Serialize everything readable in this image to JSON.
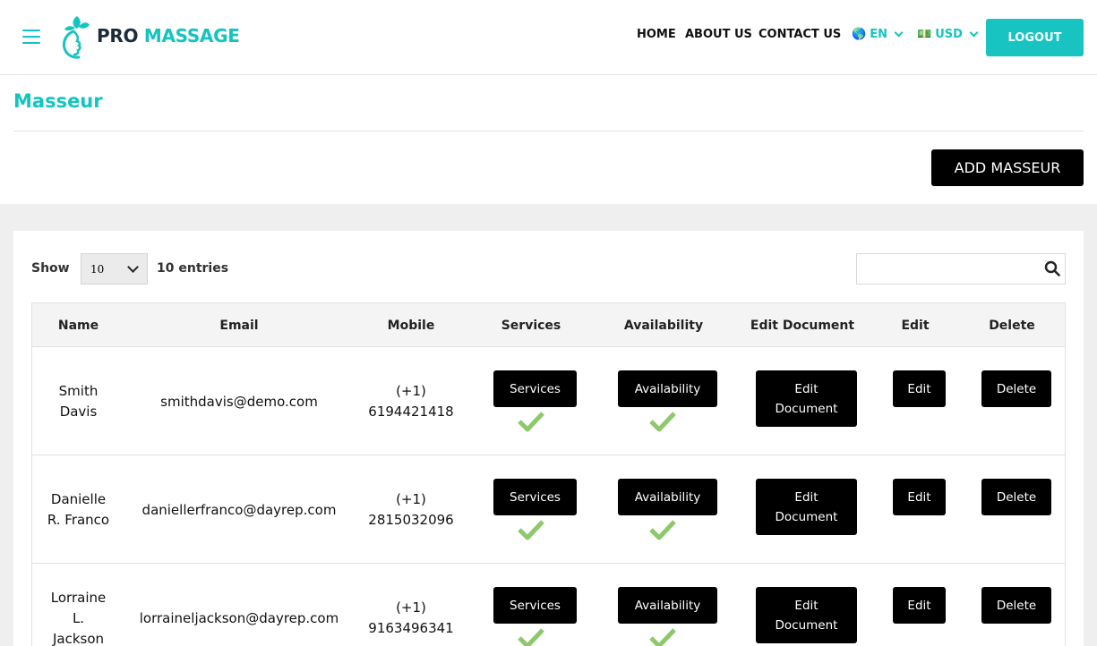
{
  "brand": {
    "pro": "PRO",
    "massage": "MASSAGE"
  },
  "nav": {
    "home": "HOME",
    "about": "ABOUT US",
    "contact": "CONTACT US"
  },
  "language": {
    "flag": "🌎",
    "code": "EN"
  },
  "currency": {
    "flag": "💵",
    "code": "USD"
  },
  "header": {
    "logout_label": "LOGOUT"
  },
  "page": {
    "title": "Masseur",
    "add_label": "ADD MASSEUR"
  },
  "list": {
    "show_label": "Show",
    "entries_value": "10",
    "entries_label": "10 entries",
    "search_value": "",
    "columns": [
      "Name",
      "Email",
      "Mobile",
      "Services",
      "Availability",
      "Edit Document",
      "Edit",
      "Delete"
    ],
    "rows": [
      {
        "name_first": "Smith",
        "name_second": "Davis",
        "name_third": "",
        "email": "smithdavis@demo.com",
        "mobile_code": "(+1)",
        "mobile_number": "6194421418",
        "services_label": "Services",
        "availability_label": "Availability",
        "doc_label_1": "Edit",
        "doc_label_2": "Document",
        "edit_label": "Edit",
        "delete_label": "Delete"
      },
      {
        "name_first": "Danielle",
        "name_second": "R. Franco",
        "name_third": "",
        "email": "daniellerfranco@dayrep.com",
        "mobile_code": "(+1)",
        "mobile_number": "2815032096",
        "services_label": "Services",
        "availability_label": "Availability",
        "doc_label_1": "Edit",
        "doc_label_2": "Document",
        "edit_label": "Edit",
        "delete_label": "Delete"
      },
      {
        "name_first": "Lorraine",
        "name_second": "L.",
        "name_third": "Jackson",
        "email": "lorraineljackson@dayrep.com",
        "mobile_code": "(+1)",
        "mobile_number": "9163496341",
        "services_label": "Services",
        "availability_label": "Availability",
        "doc_label_1": "Edit",
        "doc_label_2": "Document",
        "edit_label": "Edit",
        "delete_label": "Delete"
      }
    ]
  },
  "colors": {
    "accent": "#14c4c0",
    "check": "#8cc96a",
    "button": "#000000",
    "grey_bg": "#efefef"
  },
  "icons": {
    "menu": "hamburger-icon",
    "search": "search-icon",
    "check": "check-icon",
    "chevron": "chevron-down-icon"
  }
}
